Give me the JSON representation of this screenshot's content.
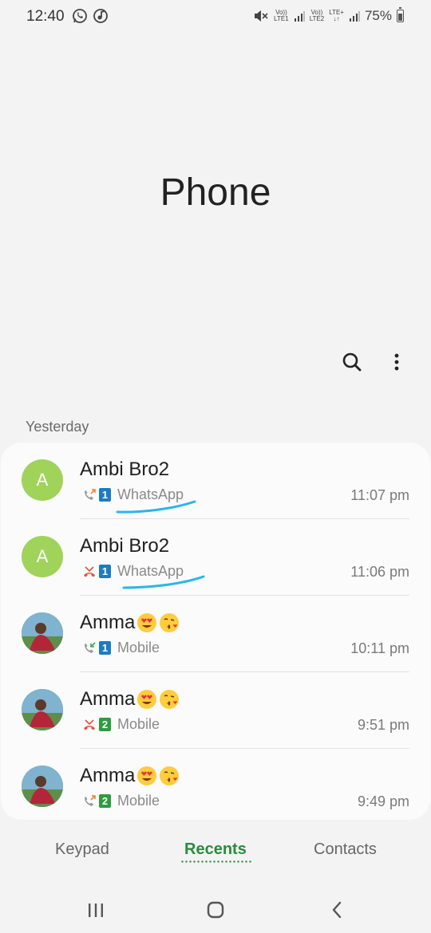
{
  "status_bar": {
    "time": "12:40",
    "icons_left": [
      "whatsapp-icon",
      "music-icon"
    ],
    "net1": [
      "Vo))",
      "LTE1"
    ],
    "net2": [
      "Vo))",
      "LTE2"
    ],
    "net2_extra": "LTE+",
    "battery": "75%",
    "battery_level": 0.75
  },
  "header": {
    "title": "Phone"
  },
  "toolbar": {
    "search_icon": "search-icon",
    "more_icon": "more-vert-icon"
  },
  "recents": {
    "section_label": "Yesterday",
    "calls": [
      {
        "name": "Ambi Bro2",
        "avatar_letter": "A",
        "avatar_type": "letter",
        "call_type": "outgoing",
        "sim": "1",
        "source": "WhatsApp",
        "time": "11:07 pm"
      },
      {
        "name": "Ambi Bro2",
        "avatar_letter": "A",
        "avatar_type": "letter",
        "call_type": "missed",
        "sim": "1",
        "source": "WhatsApp",
        "time": "11:06 pm"
      },
      {
        "name": "Amma",
        "avatar_type": "photo",
        "emojis": [
          "heart-eyes-emoji",
          "kissing-emoji"
        ],
        "call_type": "incoming",
        "sim": "1",
        "source": "Mobile",
        "time": "10:11 pm"
      },
      {
        "name": "Amma",
        "avatar_type": "photo",
        "emojis": [
          "heart-eyes-emoji",
          "kissing-emoji"
        ],
        "call_type": "missed",
        "sim": "2",
        "source": "Mobile",
        "time": "9:51 pm"
      },
      {
        "name": "Amma",
        "avatar_type": "photo",
        "emojis": [
          "heart-eyes-emoji",
          "kissing-emoji"
        ],
        "call_type": "outgoing",
        "sim": "2",
        "source": "Mobile",
        "time": "9:49 pm"
      }
    ]
  },
  "tabs": {
    "keypad": "Keypad",
    "recents": "Recents",
    "contacts": "Contacts",
    "active": "Recents"
  },
  "nav": {
    "recent_apps_icon": "recent-apps-icon",
    "home_icon": "home-icon",
    "back_icon": "back-icon"
  },
  "colors": {
    "accent": "#2a8b3f",
    "sim1": "#1e7bbf",
    "sim2": "#2e9b3f",
    "missed": "#e0533d",
    "avatar_letter": "#9fd35a",
    "scribble": "#29b6e8"
  }
}
